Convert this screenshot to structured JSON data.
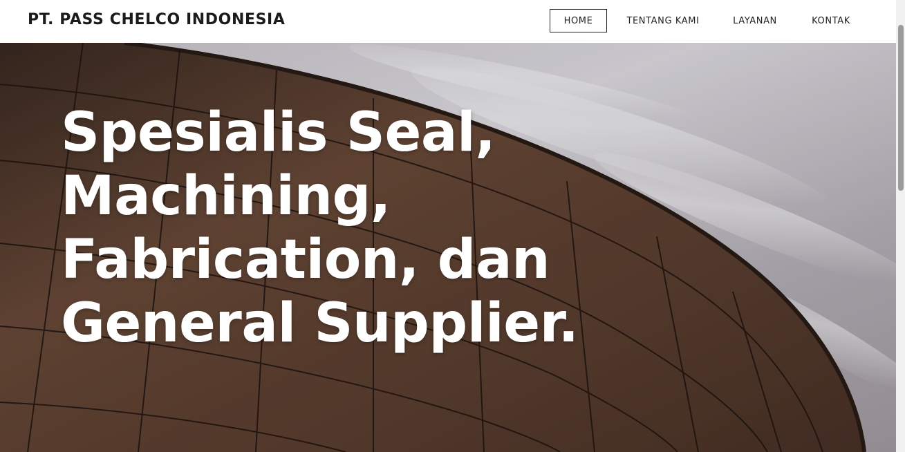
{
  "brand": "PT. PASS CHELCO INDONESIA",
  "nav": {
    "home": "HOME",
    "about": "TENTANG KAMI",
    "services": "LAYANAN",
    "contact": "KONTAK"
  },
  "hero": {
    "title_line1": "Spesialis Seal,",
    "title_line2": "Machining,",
    "title_line3": "Fabrication, dan",
    "title_line4": "General Supplier."
  },
  "colors": {
    "hero_text": "#ffffff",
    "roof": "#5a3f30",
    "sky": "#d8d5db"
  }
}
